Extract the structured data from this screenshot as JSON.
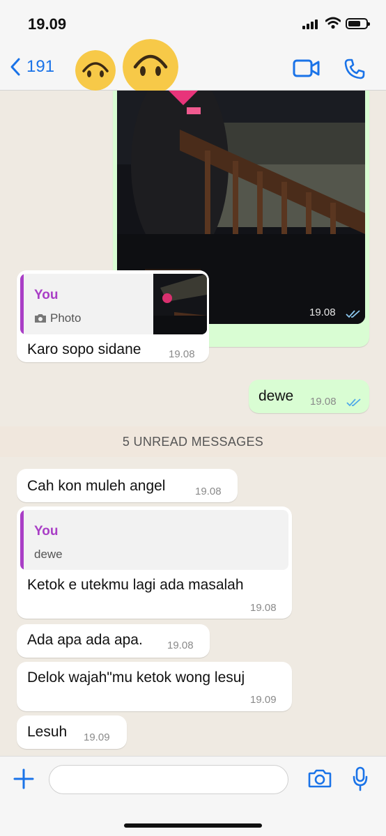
{
  "status_bar": {
    "time": "19.09"
  },
  "header": {
    "back_count": "191"
  },
  "messages": [
    {
      "id": "photo",
      "direction": "outgoing",
      "type": "photo",
      "time": "19.08",
      "read": true
    },
    {
      "id": "m1",
      "direction": "incoming",
      "quote": {
        "author": "You",
        "label": "Photo"
      },
      "text": "Karo sopo sidane",
      "time": "19.08"
    },
    {
      "id": "m2",
      "direction": "outgoing",
      "text": "dewe",
      "time": "19.08",
      "read": true
    },
    {
      "id": "m3",
      "direction": "incoming",
      "text": "Cah kon muleh angel",
      "time": "19.08"
    },
    {
      "id": "m4",
      "direction": "incoming",
      "quote": {
        "author": "You",
        "label": "dewe"
      },
      "text": "Ketok e utekmu lagi ada masalah",
      "time": "19.08"
    },
    {
      "id": "m5",
      "direction": "incoming",
      "text": "Ada apa ada apa.",
      "time": "19.08"
    },
    {
      "id": "m6",
      "direction": "incoming",
      "text": "Delok wajah\"mu ketok wong lesuj",
      "time": "19.09"
    },
    {
      "id": "m7",
      "direction": "incoming",
      "text": "Lesuh",
      "time": "19.09"
    }
  ],
  "unread_divider": "5 UNREAD MESSAGES",
  "footer": {
    "input_value": ""
  },
  "colors": {
    "accent": "#1a73e8",
    "outgoing_bubble": "#d9fdd3",
    "incoming_bubble": "#ffffff",
    "quote_author": "#a93ec6",
    "read_ticks": "#4fa8e8"
  }
}
